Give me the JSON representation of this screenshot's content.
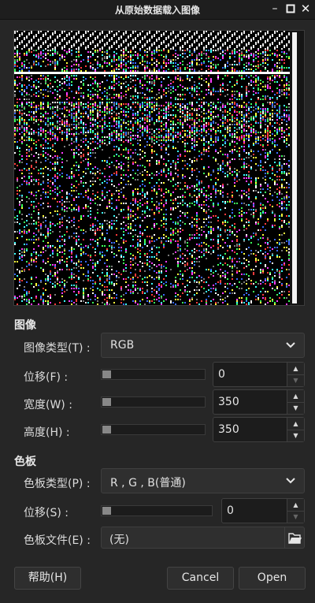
{
  "window": {
    "title": "从原始数据载入图像",
    "buttons": {
      "minimize": "minimize-icon",
      "maximize": "maximize-icon",
      "close": "close-icon"
    }
  },
  "preview": {
    "description_icon": "raw-data-preview"
  },
  "image_section": {
    "heading": "图像",
    "image_type": {
      "label": "图像类型(T) :",
      "value": "RGB"
    },
    "offset": {
      "label": "位移(F) :",
      "value": "0"
    },
    "width": {
      "label": "宽度(W) :",
      "value": "350"
    },
    "height": {
      "label": "高度(H) :",
      "value": "350"
    }
  },
  "palette_section": {
    "heading": "色板",
    "palette_type": {
      "label": "色板类型(P) :",
      "value": "R , G , B(普通)"
    },
    "offset": {
      "label": "位移(S) :",
      "value": "0"
    },
    "palette_file": {
      "label": "色板文件(E) :",
      "value": "(无)"
    }
  },
  "footer": {
    "help": "帮助(H)",
    "cancel": "Cancel",
    "open": "Open"
  },
  "icons": {
    "chevron": "chevron-down-icon",
    "folder": "folder-open-icon",
    "spin_up": "arrow-up-icon",
    "spin_down": "arrow-down-icon"
  }
}
